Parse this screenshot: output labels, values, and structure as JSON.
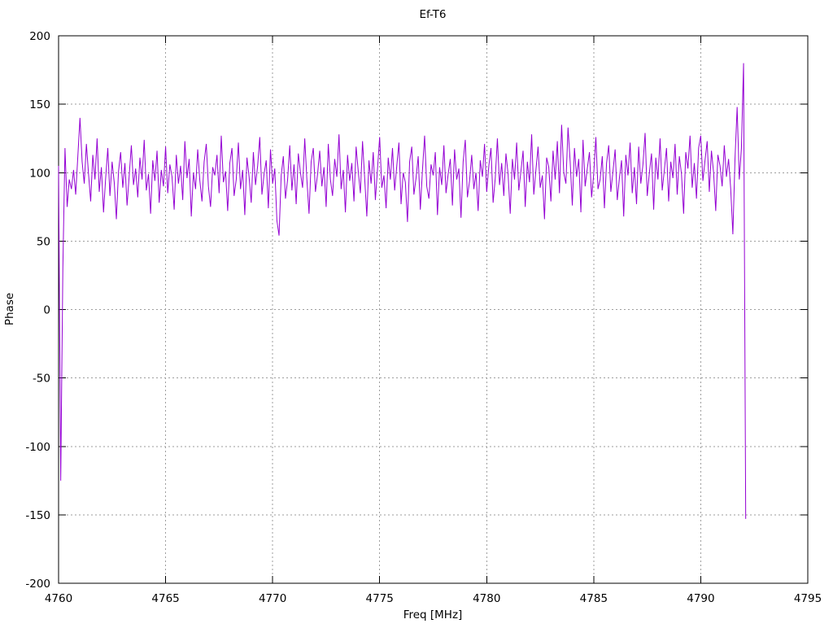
{
  "chart_data": {
    "type": "line",
    "title": "Ef-T6",
    "xlabel": "Freq [MHz]",
    "ylabel": "Phase",
    "xlim": [
      4760,
      4795
    ],
    "ylim": [
      -200,
      200
    ],
    "x_ticks": [
      4760,
      4765,
      4770,
      4775,
      4780,
      4785,
      4790,
      4795
    ],
    "y_ticks": [
      -200,
      -150,
      -100,
      -50,
      0,
      50,
      100,
      150,
      200
    ],
    "grid": true,
    "legend": "none",
    "line_color": "#9400d3",
    "grid_color": "#9e9e9e",
    "border_color": "#000000",
    "x_start": 4760.0,
    "x_step": 0.1,
    "values": [
      105,
      -125,
      30,
      118,
      75,
      95,
      88,
      102,
      84,
      112,
      140,
      108,
      92,
      121,
      99,
      79,
      113,
      95,
      125,
      86,
      104,
      71,
      96,
      118,
      83,
      108,
      93,
      66,
      101,
      115,
      89,
      107,
      76,
      98,
      120,
      91,
      103,
      82,
      111,
      95,
      124,
      87,
      99,
      70,
      109,
      94,
      116,
      78,
      102,
      90,
      119,
      85,
      106,
      97,
      73,
      113,
      92,
      105,
      80,
      123,
      96,
      110,
      68,
      100,
      88,
      117,
      94,
      79,
      108,
      121,
      90,
      75,
      104,
      98,
      113,
      85,
      127,
      93,
      101,
      72,
      107,
      118,
      83,
      95,
      122,
      88,
      102,
      69,
      111,
      97,
      78,
      115,
      91,
      105,
      126,
      84,
      99,
      109,
      74,
      117,
      92,
      103,
      65,
      54,
      98,
      112,
      81,
      95,
      120,
      87,
      106,
      77,
      114,
      100,
      89,
      125,
      95,
      70,
      108,
      118,
      86,
      99,
      116,
      90,
      104,
      75,
      121,
      95,
      83,
      110,
      97,
      128,
      88,
      102,
      71,
      113,
      94,
      107,
      79,
      119,
      101,
      85,
      123,
      96,
      68,
      109,
      92,
      115,
      80,
      103,
      126,
      89,
      98,
      74,
      111,
      95,
      118,
      87,
      105,
      122,
      77,
      100,
      93,
      64,
      108,
      119,
      84,
      96,
      112,
      73,
      102,
      127,
      90,
      81,
      106,
      98,
      115,
      69,
      104,
      91,
      120,
      85,
      99,
      110,
      76,
      117,
      95,
      103,
      67,
      108,
      124,
      82,
      94,
      113,
      88,
      100,
      72,
      109,
      97,
      121,
      86,
      105,
      118,
      78,
      96,
      125,
      91,
      107,
      83,
      114,
      99,
      70,
      110,
      95,
      122,
      87,
      101,
      116,
      75,
      108,
      93,
      128,
      84,
      102,
      119,
      89,
      98,
      66,
      111,
      104,
      79,
      116,
      95,
      123,
      85,
      135,
      100,
      92,
      133,
      108,
      76,
      118,
      97,
      110,
      71,
      124,
      90,
      103,
      115,
      82,
      99,
      126,
      88,
      95,
      112,
      74,
      107,
      120,
      86,
      101,
      117,
      80,
      96,
      109,
      68,
      113,
      98,
      122,
      85,
      104,
      77,
      119,
      92,
      106,
      129,
      83,
      100,
      114,
      73,
      111,
      95,
      125,
      87,
      102,
      118,
      79,
      108,
      96,
      121,
      84,
      112,
      99,
      70,
      115,
      103,
      127,
      89,
      107,
      81,
      118,
      127,
      94,
      109,
      123,
      86,
      116,
      100,
      72,
      113,
      105,
      90,
      120,
      97,
      110,
      88,
      55,
      110,
      148,
      95,
      118,
      180,
      -153
    ]
  }
}
